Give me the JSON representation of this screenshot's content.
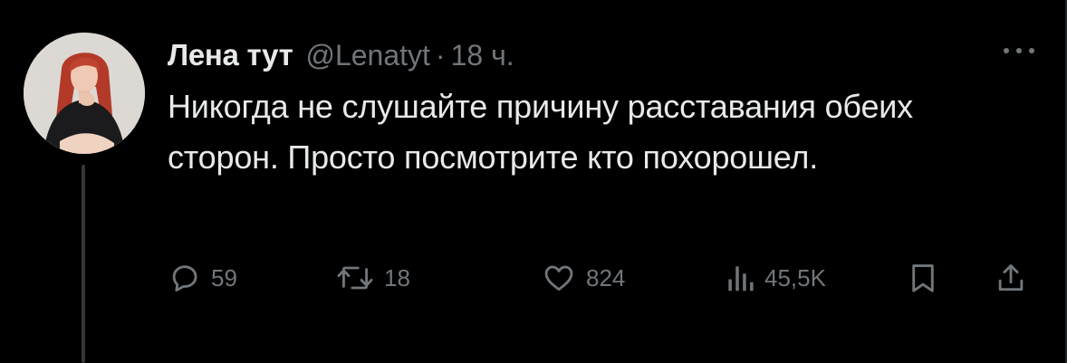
{
  "tweet": {
    "display_name": "Лена тут",
    "handle": "@Lenatyt",
    "separator": "·",
    "time": "18 ч.",
    "text": "Никогда не слушайте причину расставания обеих сторон. Просто посмотрите кто похорошел."
  },
  "actions": {
    "reply_count": "59",
    "retweet_count": "18",
    "like_count": "824",
    "views_count": "45,5K"
  },
  "icons": {
    "reply": "reply-icon",
    "retweet": "retweet-icon",
    "like": "heart-icon",
    "views": "views-icon",
    "bookmark": "bookmark-icon",
    "share": "share-icon",
    "more": "more-icon"
  },
  "colors": {
    "background": "#000000",
    "text_primary": "#e7e9ea",
    "text_secondary": "#71767b",
    "thread_line": "#333639"
  }
}
